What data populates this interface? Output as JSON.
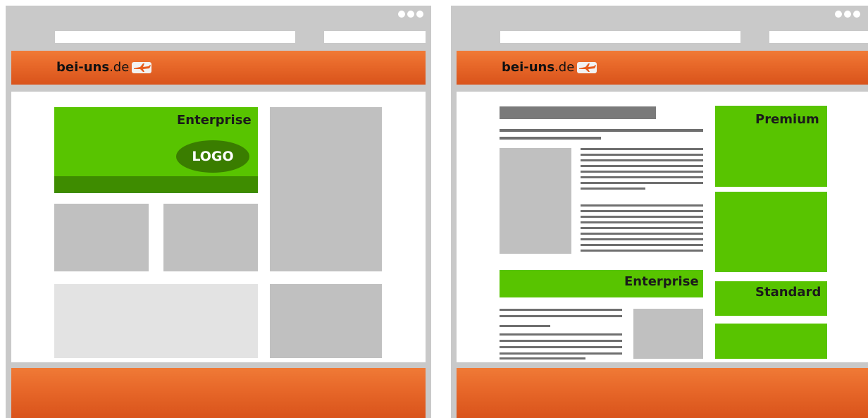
{
  "site": {
    "logo_bold": "bei-uns",
    "logo_rest": ".de"
  },
  "left_mockup": {
    "enterprise_label": "Enterprise",
    "logo_label": "LOGO"
  },
  "right_mockup": {
    "premium_label": "Premium",
    "enterprise_label": "Enterprise",
    "standard_label": "Standard"
  },
  "colors": {
    "frame": "#c9c9c9",
    "header_orange": "#e8692a",
    "ad_green": "#58c400",
    "ad_dark_green": "#3e8c00",
    "placeholder_gray": "#c0c0c0"
  }
}
